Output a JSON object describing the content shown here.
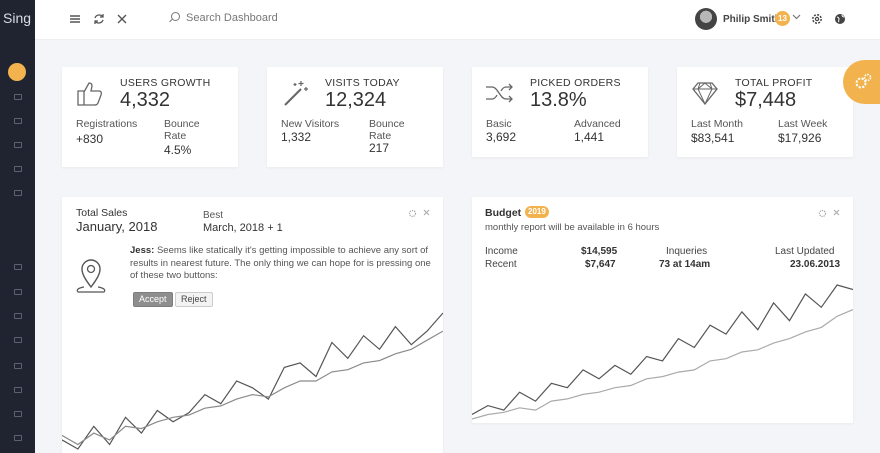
{
  "app": {
    "logo": "Sing"
  },
  "header": {
    "search_placeholder": "Search Dashboard",
    "user_name": "Philip Smith",
    "notification_count": "13",
    "icons": [
      "menu-icon",
      "refresh-icon",
      "close-icon",
      "search-icon",
      "gear-icon",
      "globe-icon"
    ]
  },
  "sidebar": {
    "items": [
      "dashboard",
      "item-2",
      "item-3",
      "item-4",
      "item-5",
      "item-6",
      "item-7",
      "item-8",
      "item-9",
      "item-10",
      "item-11",
      "item-12"
    ],
    "active_color": "#f2b34e"
  },
  "stats": [
    {
      "title": "USERS GROWTH",
      "value": "4,332",
      "icon": "thumbs-up-icon",
      "left_label": "Registrations",
      "left_value": "+830",
      "right_label": "Bounce Rate",
      "right_value": "4.5%"
    },
    {
      "title": "VISITS TODAY",
      "value": "12,324",
      "icon": "magic-wand-icon",
      "left_label": "New Visitors",
      "left_value": "1,332",
      "right_label": "Bounce Rate",
      "right_value": "217"
    },
    {
      "title": "PICKED ORDERS",
      "value": "13.8%",
      "icon": "shuffle-icon",
      "left_label": "Basic",
      "left_value": "3,692",
      "right_label": "Advanced",
      "right_value": "1,441"
    },
    {
      "title": "TOTAL PROFIT",
      "value": "$7,448",
      "icon": "diamond-icon",
      "left_label": "Last Month",
      "left_value": "$83,541",
      "right_label": "Last Week",
      "right_value": "$17,926"
    }
  ],
  "sales": {
    "title": "Total Sales",
    "period": "January, 2018",
    "best_label": "Best",
    "best_value": "March, 2018 + 1",
    "message_author": "Jess:",
    "message_text": "Seems like statically it's getting impossible to achieve any sort of results in nearest future. The only thing we can hope for is pressing one of these two buttons:",
    "accept_label": "Accept",
    "reject_label": "Reject"
  },
  "budget": {
    "title": "Budget",
    "badge": "2019",
    "subtitle": "monthly report will be available in 6 hours",
    "rows": [
      {
        "label": "Income",
        "amount": "$14,595"
      },
      {
        "label": "Recent",
        "amount": "$7,647"
      }
    ],
    "inqueries_label": "Inqueries",
    "inqueries_value": "73 at 14am",
    "updated_label": "Last Updated",
    "updated_value": "23.06.2013"
  },
  "chart_data": [
    {
      "type": "line",
      "title": "Total Sales",
      "x": [
        0,
        1,
        2,
        3,
        4,
        5,
        6,
        7,
        8,
        9,
        10,
        11,
        12,
        13,
        14,
        15,
        16,
        17,
        18,
        19,
        20,
        21,
        22,
        23,
        24
      ],
      "series": [
        {
          "values": [
            12,
            8,
            18,
            10,
            22,
            15,
            25,
            20,
            24,
            32,
            28,
            38,
            35,
            30,
            44,
            46,
            40,
            55,
            48,
            58,
            52,
            62,
            54,
            60,
            68
          ]
        },
        {
          "values": [
            14,
            10,
            15,
            12,
            18,
            17,
            20,
            22,
            23,
            26,
            27,
            30,
            32,
            31,
            35,
            38,
            38,
            42,
            43,
            46,
            47,
            50,
            52,
            56,
            60
          ]
        }
      ]
    },
    {
      "type": "line",
      "title": "Budget",
      "x": [
        0,
        1,
        2,
        3,
        4,
        5,
        6,
        7,
        8,
        9,
        10,
        11,
        12,
        13,
        14,
        15,
        16,
        17,
        18,
        19,
        20,
        21,
        22,
        23,
        24
      ],
      "series": [
        {
          "values": [
            8,
            12,
            10,
            18,
            14,
            22,
            20,
            28,
            24,
            30,
            26,
            34,
            32,
            42,
            38,
            48,
            44,
            54,
            46,
            58,
            50,
            62,
            56,
            66,
            64
          ]
        },
        {
          "values": [
            6,
            8,
            9,
            11,
            10,
            14,
            15,
            17,
            18,
            20,
            21,
            24,
            25,
            27,
            28,
            32,
            33,
            36,
            37,
            40,
            42,
            45,
            47,
            52,
            55
          ]
        }
      ]
    }
  ]
}
